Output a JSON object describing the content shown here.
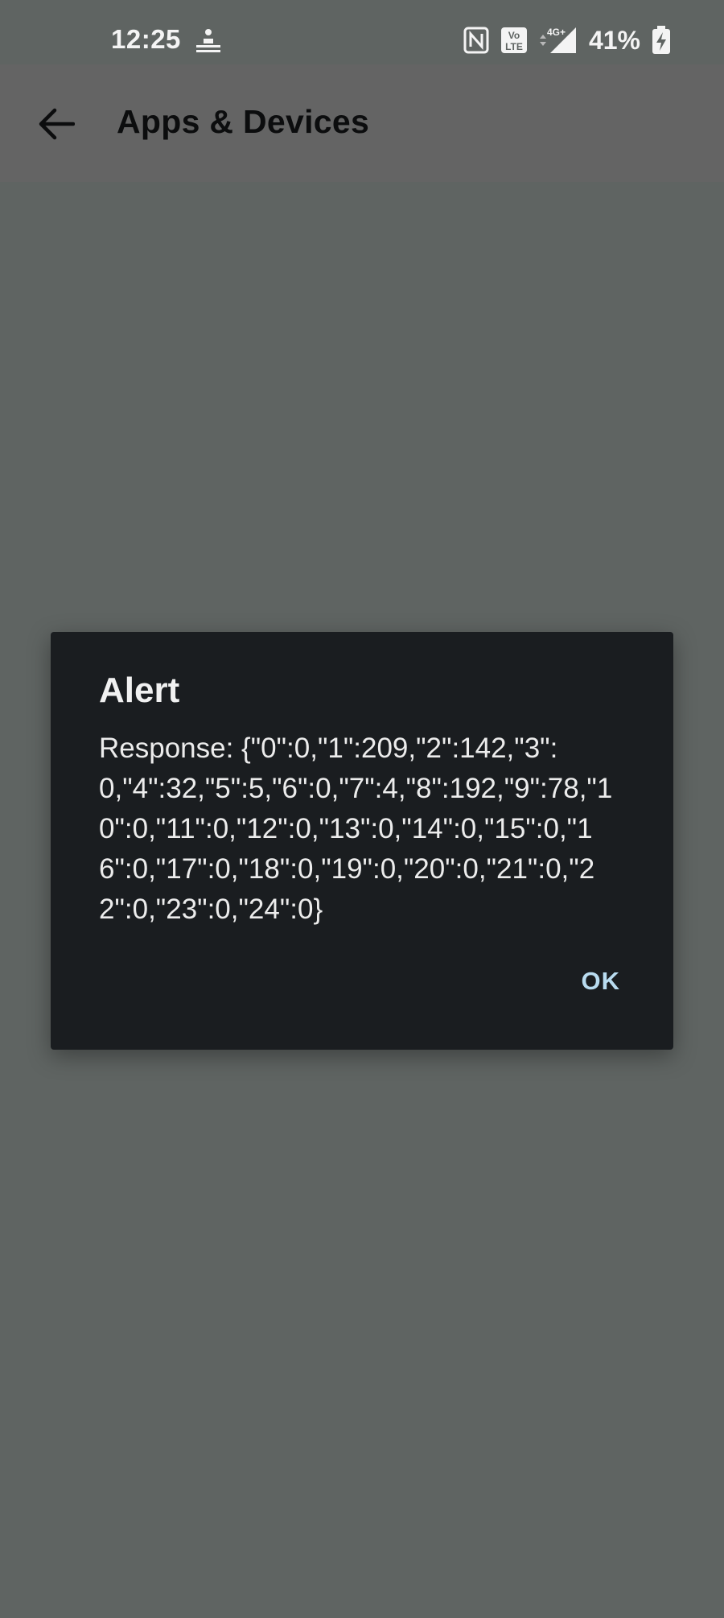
{
  "status_bar": {
    "time": "12:25",
    "battery_percent": "41%",
    "network_label": "4G+",
    "volte_label_top": "Vo",
    "volte_label_bottom": "LTE"
  },
  "app_bar": {
    "title": "Apps & Devices"
  },
  "dialog": {
    "title": "Alert",
    "message": "Response: {\"0\":0,\"1\":209,\"2\":142,\"3\":0,\"4\":32,\"5\":5,\"6\":0,\"7\":4,\"8\":192,\"9\":78,\"10\":0,\"11\":0,\"12\":0,\"13\":0,\"14\":0,\"15\":0,\"16\":0,\"17\":0,\"18\":0,\"19\":0,\"20\":0,\"21\":0,\"22\":0,\"23\":0,\"24\":0}",
    "ok_label": "OK"
  },
  "colors": {
    "background": "#5f6462",
    "app_bar": "#646464",
    "dialog_bg": "#1a1d20",
    "ok_accent": "#b9dcf0"
  }
}
